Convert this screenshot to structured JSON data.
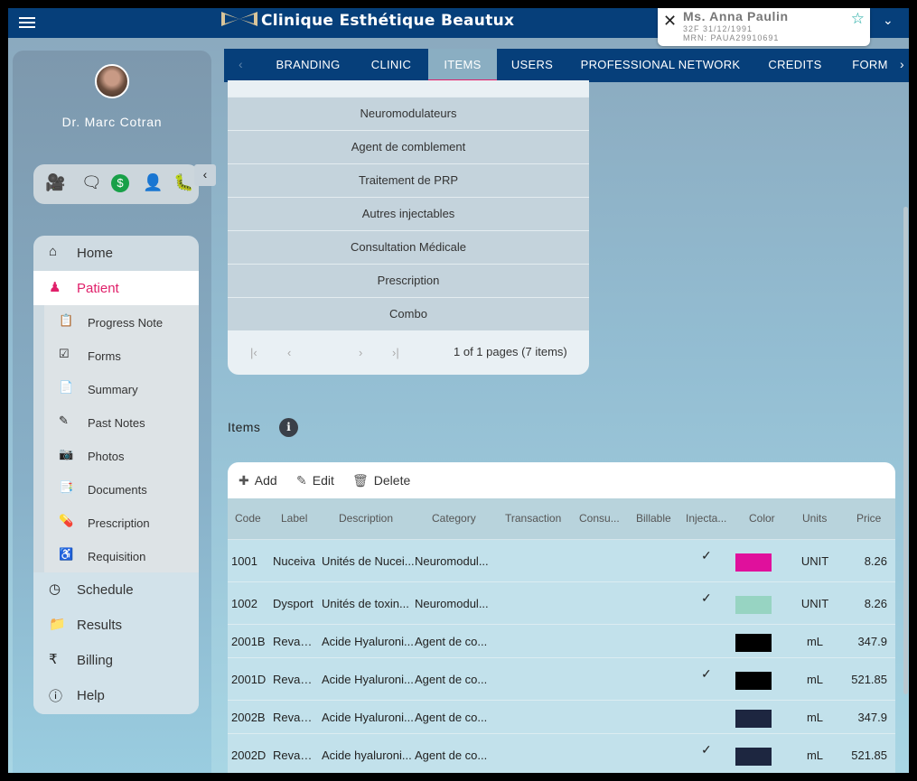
{
  "app": {
    "title": "Clinique Esthétique Beautux"
  },
  "patient": {
    "name": "Ms. Anna Paulin",
    "line1": "32F 31/12/1991",
    "line2": "MRN: PAUA29910691"
  },
  "tabs": [
    "BRANDING",
    "CLINIC",
    "ITEMS",
    "USERS",
    "PROFESSIONAL NETWORK",
    "CREDITS",
    "FORM"
  ],
  "active_tab": "ITEMS",
  "sidebar": {
    "doctor": "Dr. Marc Cotran",
    "nav": [
      {
        "label": "Home",
        "icon": "home-icon"
      },
      {
        "label": "Patient",
        "icon": "patient-icon"
      }
    ],
    "sub": [
      {
        "label": "Progress Note",
        "icon": "clipboard-icon"
      },
      {
        "label": "Forms",
        "icon": "checklist-icon"
      },
      {
        "label": "Summary",
        "icon": "summary-icon"
      },
      {
        "label": "Past Notes",
        "icon": "edit-notes-icon"
      },
      {
        "label": "Photos",
        "icon": "camera-icon"
      },
      {
        "label": "Documents",
        "icon": "documents-icon"
      },
      {
        "label": "Prescription",
        "icon": "medication-icon"
      },
      {
        "label": "Requisition",
        "icon": "accessibility-icon"
      }
    ],
    "lower": [
      {
        "label": "Schedule",
        "icon": "clock-icon"
      },
      {
        "label": "Results",
        "icon": "results-icon"
      },
      {
        "label": "Billing",
        "icon": "rupee-icon"
      },
      {
        "label": "Help",
        "icon": "info-icon"
      }
    ]
  },
  "categories": [
    "Neuromodulateurs",
    "Agent de comblement",
    "Traitement de PRP",
    "Autres injectables",
    "Consultation Médicale",
    "Prescription",
    "Combo"
  ],
  "pager": {
    "info": "1 of 1 pages (7 items)"
  },
  "items": {
    "label": "Items",
    "toolbar": {
      "add": "Add",
      "edit": "Edit",
      "delete": "Delete"
    },
    "columns": [
      "Code",
      "Label",
      "Description",
      "Category",
      "Transaction",
      "Consu...",
      "Billable",
      "Injecta...",
      "Color",
      "Units",
      "Price"
    ],
    "rows": [
      {
        "code": "1001",
        "label": "Nuceiva",
        "description": "Unités de Nucei...",
        "category": "Neuromodul...",
        "injectable": true,
        "color": "#e0109c",
        "units": "UNIT",
        "price": "8.26"
      },
      {
        "code": "1002",
        "label": "Dysport",
        "description": "Unités de toxin...",
        "category": "Neuromodul...",
        "injectable": true,
        "color": "#97d4c2",
        "units": "UNIT",
        "price": "8.26"
      },
      {
        "code": "2001B",
        "label": "Revane...",
        "description": "Acide Hyaluroni...",
        "category": "Agent de co...",
        "injectable": false,
        "color": "#000000",
        "units": "mL",
        "price": "347.9"
      },
      {
        "code": "2001D",
        "label": "Revane...",
        "description": "Acide Hyaluroni...",
        "category": "Agent de co...",
        "injectable": true,
        "color": "#000000",
        "units": "mL",
        "price": "521.85"
      },
      {
        "code": "2002B",
        "label": "Revane...",
        "description": "Acide Hyaluroni...",
        "category": "Agent de co...",
        "injectable": false,
        "color": "#1d2640",
        "units": "mL",
        "price": "347.9"
      },
      {
        "code": "2002D",
        "label": "Revane...",
        "description": "Acide hyaluroni...",
        "category": "Agent de co...",
        "injectable": true,
        "color": "#1d2640",
        "units": "mL",
        "price": "521.85"
      }
    ]
  },
  "colors": {
    "accent": "#e0206a",
    "topbar": "#063f7a",
    "star": "#17a8a0"
  }
}
